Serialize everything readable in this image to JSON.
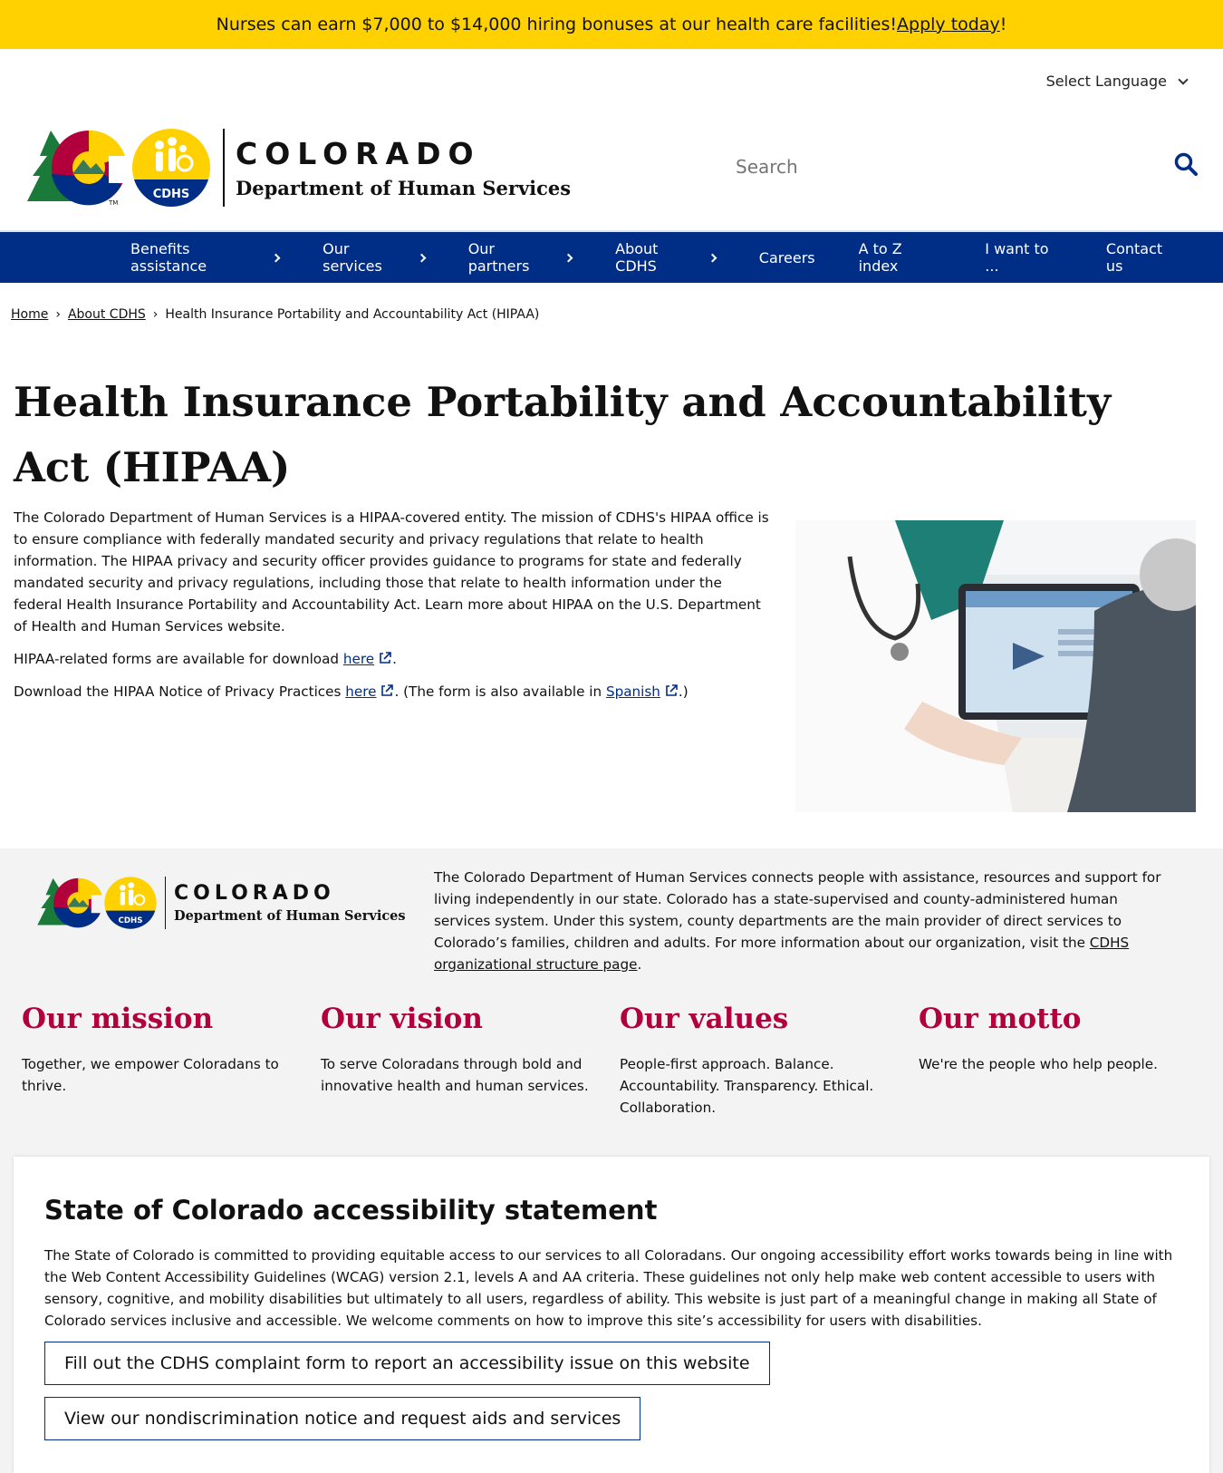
{
  "alert": {
    "text_before": "Nurses can earn $7,000 to $14,000 hiring bonuses at our health care facilities! ",
    "link": "Apply today",
    "text_after": "!"
  },
  "language": {
    "label": "Select Language"
  },
  "header": {
    "logo_title": "COLORADO",
    "logo_subtitle": "Department of Human Services",
    "logo_badge": "CDHS"
  },
  "search": {
    "placeholder": "Search"
  },
  "nav": [
    {
      "label": "Benefits assistance",
      "has_arrow": true
    },
    {
      "label": "Our services",
      "has_arrow": true
    },
    {
      "label": "Our partners",
      "has_arrow": true
    },
    {
      "label": "About CDHS",
      "has_arrow": true
    },
    {
      "label": "Careers",
      "has_arrow": false
    },
    {
      "label": "A to Z index",
      "has_arrow": false
    },
    {
      "label": "I want to ...",
      "has_arrow": false
    },
    {
      "label": "Contact us",
      "has_arrow": false
    }
  ],
  "breadcrumb": {
    "home": "Home",
    "about": "About CDHS",
    "current": "Health Insurance Portability and Accountability Act (HIPAA)"
  },
  "page": {
    "title": "Health Insurance Portability and Accountability Act (HIPAA)",
    "intro": "The Colorado Department of Human Services is a HIPAA-covered entity. The mission of CDHS's HIPAA office is to ensure compliance with federally mandated security and privacy regulations that relate to health information. The HIPAA privacy and security officer provides guidance to programs for state and federally mandated security and privacy regulations, including those that relate to health information under the federal Health Insurance Portability and Accountability Act. Learn more about HIPAA on the U.S. Department of Health and Human Services website.",
    "forms_text": "HIPAA-related forms are available for download ",
    "forms_link": "here",
    "forms_end": ".",
    "notice_text": "Download the HIPAA Notice of Privacy Practices ",
    "notice_link": "here",
    "notice_mid": ". (The form is also available in ",
    "spanish_link": "Spanish",
    "notice_end": ".)"
  },
  "footer": {
    "about_text": "The Colorado Department of Human Services connects people with assistance, resources and support for living independently in our state. Colorado has a state-supervised and county-administered human services system. Under this system, county departments are the main provider of direct services to Colorado’s families, children and adults. For more information about our organization, visit the ",
    "about_link": "CDHS organizational structure page",
    "about_end": ".",
    "columns": [
      {
        "heading": "Our mission",
        "text": "Together, we empower Coloradans to thrive."
      },
      {
        "heading": "Our vision",
        "text": "To serve Coloradans through bold and innovative health and human services."
      },
      {
        "heading": "Our values",
        "text": "People-first approach. Balance. Accountability. Transparency. Ethical. Collaboration."
      },
      {
        "heading": "Our motto",
        "text": "We're the people who help people."
      }
    ]
  },
  "accessibility": {
    "heading": "State of Colorado accessibility statement",
    "text": "The State of Colorado is committed to providing equitable access to our services to all Coloradans. Our ongoing accessibility effort works towards being in line with the Web Content Accessibility Guidelines (WCAG) version 2.1, levels A and AA criteria. These guidelines not only help make web content accessible to users with sensory, cognitive, and mobility disabilities but ultimately to all users, regardless of ability. This website is just part of a meaningful change in making all State of Colorado services inclusive and accessible. We welcome comments on how to improve this site’s accessibility for users with disabilities.",
    "button1": "Fill out the CDHS complaint form to report an accessibility issue on this website",
    "button2": "View our nondiscrimination notice and request aids and services"
  },
  "colors": {
    "alert_bg": "#ffd100",
    "nav_bg": "#002d86",
    "heading_accent": "#b1003b",
    "link": "#002d86",
    "footer_bg": "#f3f3f3"
  }
}
